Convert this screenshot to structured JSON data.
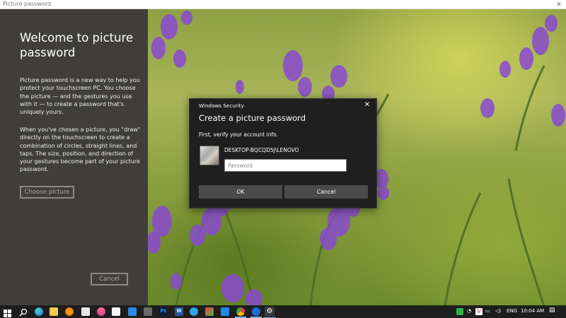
{
  "window": {
    "title": "Picture password",
    "close_icon": "close-icon"
  },
  "left_panel": {
    "heading": "Welcome to picture password",
    "paragraph1": "Picture password is a new way to help you protect your touchscreen PC. You choose the picture — and the gestures you use with it — to create a password that's uniquely yours.",
    "paragraph2": "When you've chosen a picture, you \"draw\" directly on the touchscreen to create a combination of circles, straight lines, and taps. The size, position, and direction of your gestures become part of your picture password.",
    "choose_button": "Choose picture",
    "cancel_button": "Cancel"
  },
  "dialog": {
    "title": "Windows Security",
    "heading": "Create a picture password",
    "subheading": "First, verify your account info.",
    "account_name": "DESKTOP-BQCQD5J\\LENOVO",
    "password_value": "",
    "password_placeholder": "Password",
    "ok_button": "OK",
    "cancel_button": "Cancel"
  },
  "taskbar": {
    "icons": [
      "windows-start-icon",
      "search-icon",
      "edge-icon",
      "file-explorer-icon",
      "firefox-icon",
      "store-icon",
      "app-icon",
      "app-icon",
      "mail-icon",
      "camera-icon",
      "photoshop-icon",
      "word-icon",
      "telegram-icon",
      "app-icon",
      "app-icon",
      "chrome-icon",
      "app-icon",
      "settings-icon"
    ],
    "photoshop_label": "Ps",
    "word_label": "W",
    "language": "ENG",
    "time": "10:04 AM"
  },
  "colors": {
    "left_panel_bg": "#3f3e3b",
    "dialog_bg": "#1f1f1f",
    "taskbar_bg": "#1e1e1e",
    "accent": "#7ab5ea"
  }
}
